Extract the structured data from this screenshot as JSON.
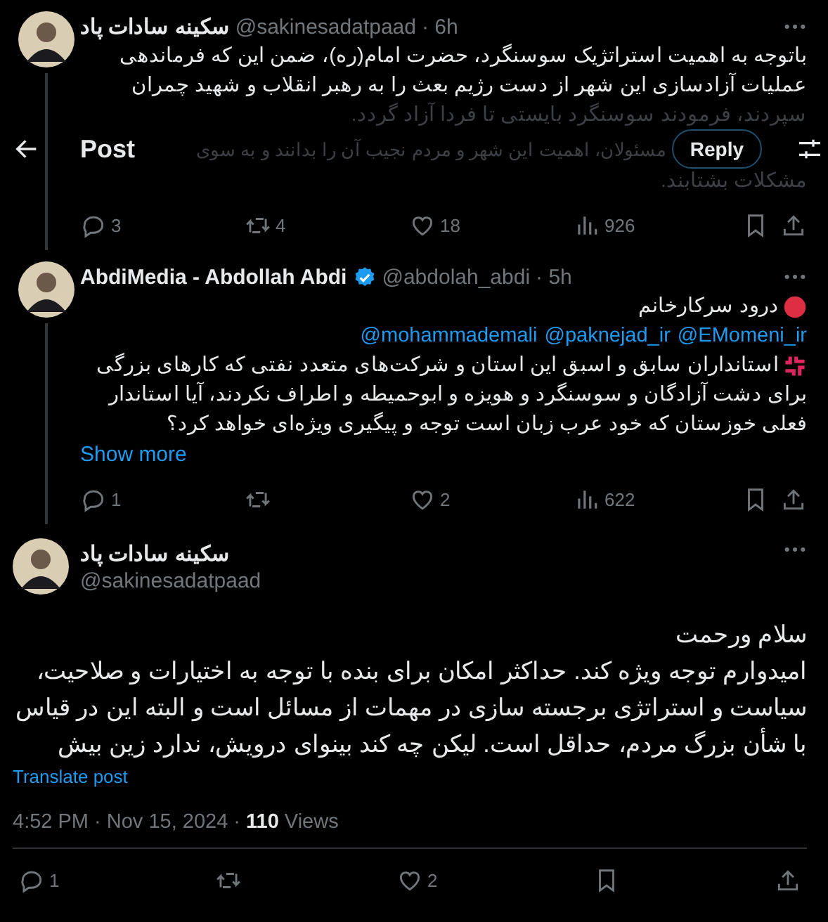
{
  "header": {
    "title": "Post",
    "reply_button": "Reply"
  },
  "posts": [
    {
      "author": {
        "name": "سکینه سادات پاد",
        "handle": "@sakinesadatpaad",
        "time": "· 6h",
        "verified": false
      },
      "connected": true,
      "text_lines": [
        "باتوجه به اهمیت استراتژیک سوسنگرد، حضرت امام(ره)، ضمن این که فرماندهی",
        "عملیات آزادسازی این شهر از دست رژیم بعث را به رهبر انقلاب و شهید چمران"
      ],
      "covered_text": {
        "above": "سپردند، فرمودند سوسنگرد بایستی تا فردا آزاد گردد.",
        "beside_header": "مسئولان، اهمیت این شهر و مردم نجیب آن را بدانند و به سوی",
        "below": "مشکلات بشتابند."
      },
      "actions": {
        "replies": "3",
        "reposts": "4",
        "likes": "18",
        "views": "926"
      }
    },
    {
      "author": {
        "name": "AbdiMedia - Abdollah Abdi",
        "handle": "@abdolah_abdi",
        "time": "· 5h",
        "verified": true
      },
      "connected": true,
      "blocks": [
        {
          "kind": "dot-line",
          "lines": [
            "درود سرکارخانم"
          ]
        },
        {
          "kind": "mentions",
          "mentions": [
            "@EMomeni_ir",
            "@paknejad_ir",
            "@mohammademali"
          ]
        },
        {
          "kind": "anger-lines",
          "lines": [
            "استانداران سابق و اسبق این استان و شرکت‌های متعدد نفتی که کارهای بزرگی",
            "برای دشت آزادگان و سوسنگرد و هویزه و ابوحمیطه و اطراف نکردند، آیا استاندار",
            "فعلی خوزستان که خود عرب زبان است توجه و پیگیری ویژه‌ای خواهد کرد؟"
          ]
        }
      ],
      "show_more": "Show more",
      "actions": {
        "replies": "1",
        "likes": "2",
        "views": "622"
      }
    }
  ],
  "main_post": {
    "author": {
      "name": "سکینه سادات پاد",
      "handle": "@sakinesadatpaad"
    },
    "text_lines": [
      "سلام ورحمت",
      "امیدوارم توجه ویژه کند. حداکثر امکان برای بنده با توجه به اختیارات و صلاحیت،",
      "سیاست و استراتژی برجسته سازی در مهمات از مسائل است و البته این در قیاس",
      "با شأن بزرگ مردم، حداقل است. لیکن چه کند بینوای درویش، ندارد زین بیش"
    ],
    "translate": "Translate post",
    "timestamp": "4:52 PM · Nov 15, 2024 ·",
    "views_count": "110",
    "views_label": "Views",
    "actions": {
      "replies": "1",
      "likes": "2"
    }
  }
}
